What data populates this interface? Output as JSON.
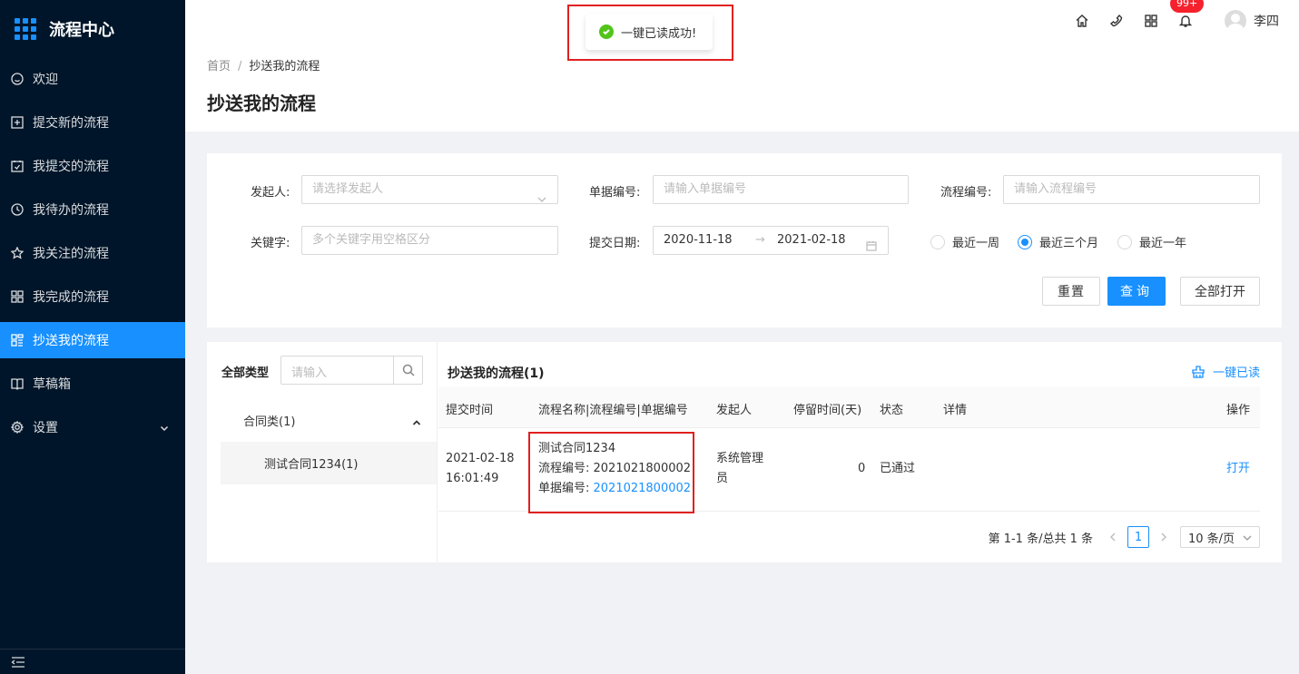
{
  "app": {
    "title": "流程中心"
  },
  "sidebar": {
    "items": [
      {
        "label": "欢迎",
        "icon": "smile-icon"
      },
      {
        "label": "提交新的流程",
        "icon": "plus-square-icon"
      },
      {
        "label": "我提交的流程",
        "icon": "calendar-check-icon"
      },
      {
        "label": "我待办的流程",
        "icon": "clock-icon"
      },
      {
        "label": "我关注的流程",
        "icon": "star-icon"
      },
      {
        "label": "我完成的流程",
        "icon": "appstore-icon"
      },
      {
        "label": "抄送我的流程",
        "icon": "cc-icon",
        "active": true
      },
      {
        "label": "草稿箱",
        "icon": "book-icon"
      },
      {
        "label": "设置",
        "icon": "gear-icon"
      }
    ]
  },
  "header": {
    "notification_badge": "99+",
    "user_name": "李四"
  },
  "toast": {
    "message": "一键已读成功!"
  },
  "breadcrumb": {
    "home": "首页",
    "separator": "/",
    "current": "抄送我的流程"
  },
  "page": {
    "title": "抄送我的流程"
  },
  "filters": {
    "initiator_label": "发起人:",
    "initiator_placeholder": "请选择发起人",
    "doc_no_label": "单据编号:",
    "doc_no_placeholder": "请输入单据编号",
    "flow_no_label": "流程编号:",
    "flow_no_placeholder": "请输入流程编号",
    "keyword_label": "关键字:",
    "keyword_placeholder": "多个关键字用空格区分",
    "date_label": "提交日期:",
    "date_start": "2020-11-18",
    "date_arrow": "→",
    "date_end": "2021-02-18",
    "ranges": [
      {
        "label": "最近一周",
        "checked": false
      },
      {
        "label": "最近三个月",
        "checked": true
      },
      {
        "label": "最近一年",
        "checked": false
      }
    ],
    "reset_button": "重置",
    "search_button": "查询",
    "expand_button": "全部打开"
  },
  "left_panel": {
    "all_types_label": "全部类型",
    "search_placeholder": "请输入",
    "tree": {
      "parent": "合同类(1)",
      "child": "测试合同1234(1)"
    }
  },
  "table": {
    "title": "抄送我的流程(1)",
    "mark_all_read": "一键已读",
    "columns": [
      "提交时间",
      "流程名称|流程编号|单据编号",
      "发起人",
      "停留时间(天)",
      "状态",
      "详情",
      "操作"
    ],
    "rows": [
      {
        "submit_date": "2021-02-18",
        "submit_time": "16:01:49",
        "flow_name": "测试合同1234",
        "flow_no_label": "流程编号: ",
        "flow_no": "2021021800002",
        "doc_no_label": "单据编号: ",
        "doc_no": "2021021800002",
        "initiator_line1": "系统管理",
        "initiator_line2": "员",
        "stay_days": "0",
        "status": "已通过",
        "detail": "",
        "action": "打开"
      }
    ]
  },
  "pagination": {
    "summary": "第 1-1 条/总共 1 条",
    "current_page": "1",
    "page_size": "10 条/页"
  },
  "colors": {
    "primary": "#1890ff",
    "sidebar_bg": "#001529",
    "success": "#52c41a",
    "highlight": "#e02020"
  }
}
